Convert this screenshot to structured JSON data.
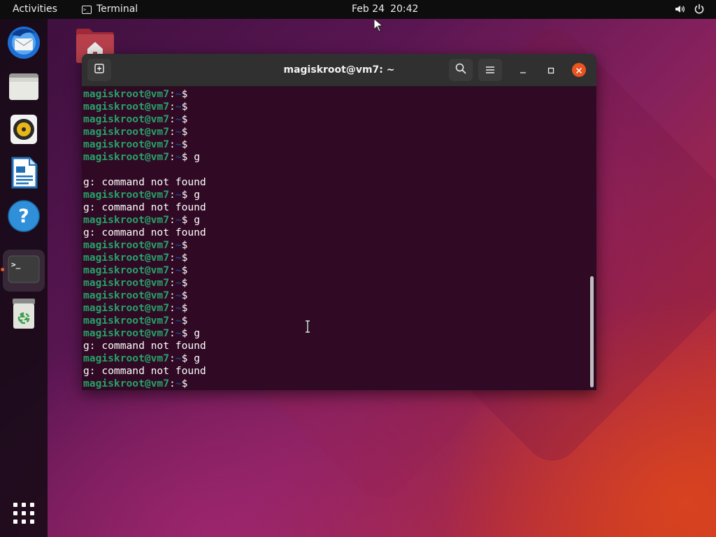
{
  "topbar": {
    "activities": "Activities",
    "app_name": "Terminal",
    "date": "Feb 24",
    "time": "20:42",
    "app_icon_glyph": ">_",
    "volume_icon": "volume-icon",
    "power_icon": "power-icon"
  },
  "dock": {
    "items": [
      {
        "name": "Thunderbird Mail",
        "icon": "thunderbird-icon"
      },
      {
        "name": "Files",
        "icon": "files-icon"
      },
      {
        "name": "Rhythmbox",
        "icon": "rhythmbox-icon"
      },
      {
        "name": "LibreOffice Writer",
        "icon": "libreoffice-writer-icon"
      },
      {
        "name": "Help",
        "icon": "help-icon",
        "glyph": "?"
      },
      {
        "name": "Terminal",
        "icon": "terminal-icon",
        "glyph": ">_",
        "running": true
      },
      {
        "name": "Trash",
        "icon": "trash-icon"
      }
    ],
    "show_apps_icon": "app-grid-icon"
  },
  "desktop": {
    "home_icon": "home-folder-icon"
  },
  "terminal": {
    "title": "magiskroot@vm7: ~",
    "prompt": {
      "user_host": "magiskroot@vm7",
      "colon": ":",
      "path": "~",
      "dollar": "$"
    },
    "lines": [
      {
        "type": "prompt",
        "cmd": ""
      },
      {
        "type": "prompt",
        "cmd": ""
      },
      {
        "type": "prompt",
        "cmd": ""
      },
      {
        "type": "prompt",
        "cmd": ""
      },
      {
        "type": "prompt",
        "cmd": ""
      },
      {
        "type": "prompt",
        "cmd": " g"
      },
      {
        "type": "output",
        "text": ""
      },
      {
        "type": "output",
        "text": "g: command not found"
      },
      {
        "type": "prompt",
        "cmd": " g"
      },
      {
        "type": "output",
        "text": "g: command not found"
      },
      {
        "type": "prompt",
        "cmd": " g"
      },
      {
        "type": "output",
        "text": "g: command not found"
      },
      {
        "type": "prompt",
        "cmd": ""
      },
      {
        "type": "prompt",
        "cmd": ""
      },
      {
        "type": "prompt",
        "cmd": ""
      },
      {
        "type": "prompt",
        "cmd": ""
      },
      {
        "type": "prompt",
        "cmd": ""
      },
      {
        "type": "prompt",
        "cmd": ""
      },
      {
        "type": "prompt",
        "cmd": ""
      },
      {
        "type": "prompt",
        "cmd": " g"
      },
      {
        "type": "output",
        "text": "g: command not found"
      },
      {
        "type": "prompt",
        "cmd": " g"
      },
      {
        "type": "output",
        "text": "g: command not found"
      },
      {
        "type": "prompt",
        "cmd": ""
      }
    ],
    "buttons": {
      "new_tab_icon": "new-tab-icon",
      "search_icon": "search-icon",
      "menu_icon": "hamburger-menu-icon",
      "minimize_icon": "minimize-icon",
      "maximize_icon": "maximize-icon",
      "close_icon": "close-icon"
    }
  },
  "colors": {
    "terminal_bg": "#300a24",
    "prompt_user": "#26a269",
    "prompt_path": "#12488b",
    "accent": "#e95420"
  }
}
